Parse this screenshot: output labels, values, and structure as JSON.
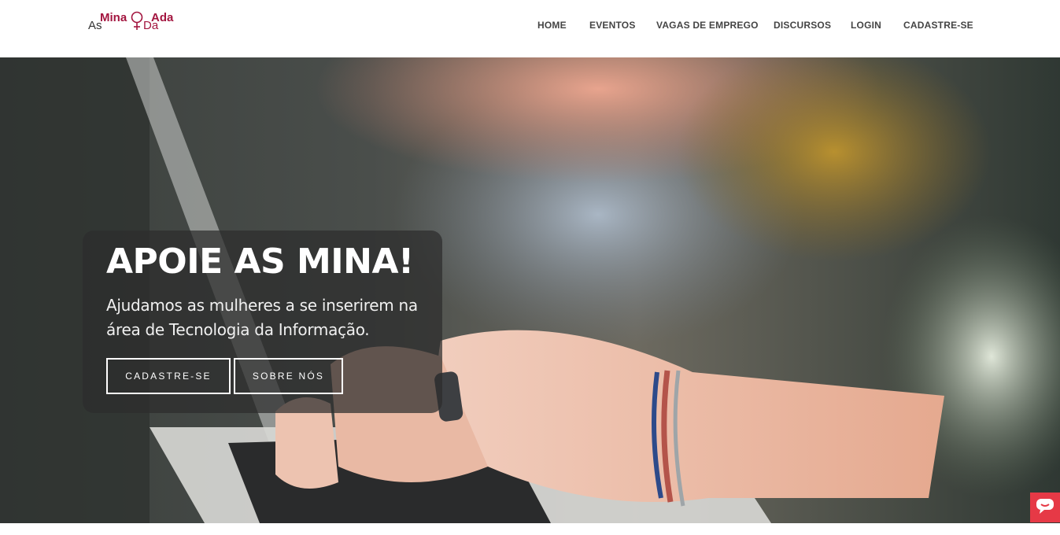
{
  "logo": {
    "part_as": "As",
    "part_mina": "Mina",
    "part_da": "Da",
    "part_ada": "Ada",
    "icon": "venus-symbol-icon",
    "color": "#a3153f"
  },
  "nav": {
    "items": [
      "HOME",
      "EVENTOS",
      "VAGAS DE EMPREGO",
      "DISCURSOS",
      "LOGIN",
      "CADASTRE-SE"
    ]
  },
  "hero": {
    "title": "APOIE AS MINA!",
    "subtitle": "Ajudamos as mulheres a se inserirem na área de Tecnologia da Informação.",
    "buttons": {
      "signup": "CADASTRE-SE",
      "about": "SOBRE NÓS"
    },
    "background": "photo-hands-typing-on-laptop"
  },
  "chat_widget": {
    "icon": "chat-bubble-icon",
    "color": "#e63946"
  }
}
